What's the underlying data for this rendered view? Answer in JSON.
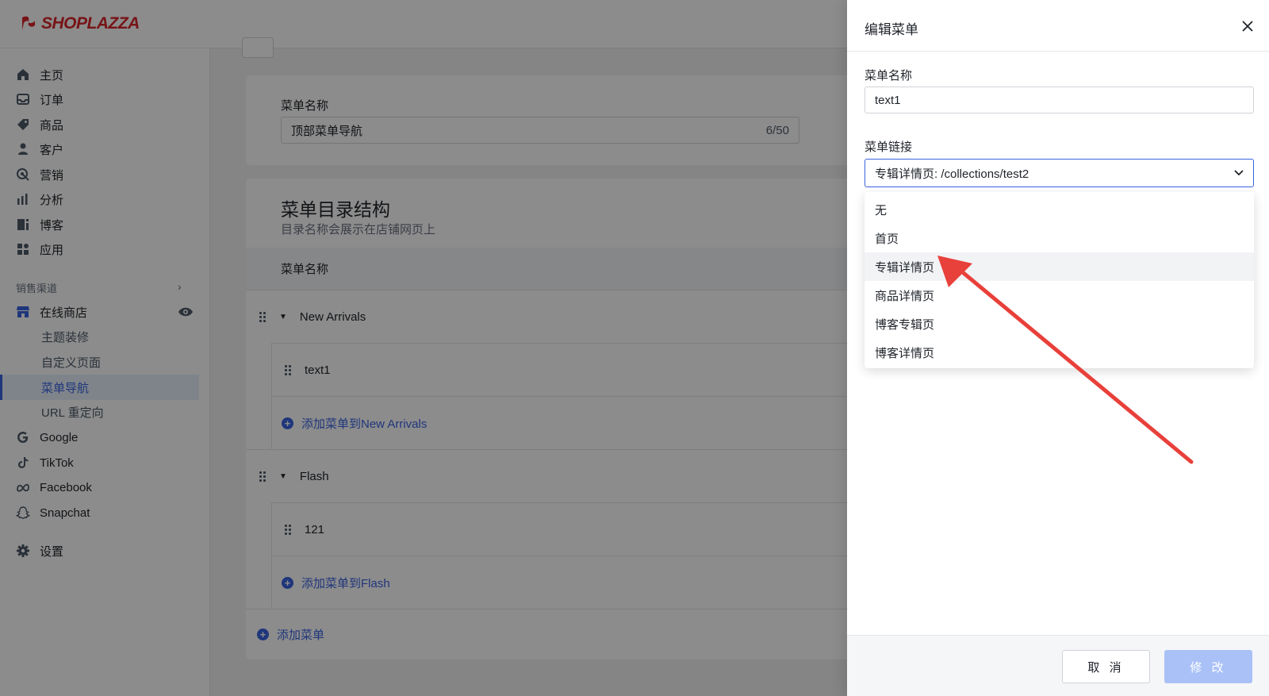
{
  "brand": {
    "name": "SHOPLAZZA",
    "color": "#d9262a"
  },
  "accent": "#3a63e0",
  "sidebar": {
    "items": [
      {
        "label": "主页",
        "icon": "home-icon"
      },
      {
        "label": "订单",
        "icon": "inbox-icon"
      },
      {
        "label": "商品",
        "icon": "tag-icon"
      },
      {
        "label": "客户",
        "icon": "person-icon"
      },
      {
        "label": "营销",
        "icon": "target-icon"
      },
      {
        "label": "分析",
        "icon": "bar-chart-icon"
      },
      {
        "label": "博客",
        "icon": "blog-icon"
      },
      {
        "label": "应用",
        "icon": "apps-icon"
      }
    ],
    "section_label": "销售渠道",
    "store": {
      "label": "在线商店",
      "icon": "store-icon"
    },
    "store_sub": [
      "主题装修",
      "自定义页面",
      "菜单导航",
      "URL 重定向"
    ],
    "active_sub": "菜单导航",
    "channels": [
      {
        "label": "Google",
        "icon": "google-icon"
      },
      {
        "label": "TikTok",
        "icon": "tiktok-icon"
      },
      {
        "label": "Facebook",
        "icon": "meta-icon"
      },
      {
        "label": "Snapchat",
        "icon": "snapchat-icon"
      }
    ],
    "settings": {
      "label": "设置",
      "icon": "gear-icon"
    }
  },
  "main": {
    "name_card": {
      "label": "菜单名称",
      "value": "顶部菜单导航",
      "counter": "6/50"
    },
    "tree": {
      "title": "菜单目录结构",
      "subtitle": "目录名称会展示在店铺网页上",
      "column_header": "菜单名称",
      "groups": [
        {
          "label": "New Arrivals",
          "children": [
            "text1"
          ],
          "add_label": "添加菜单到New Arrivals"
        },
        {
          "label": "Flash",
          "children": [
            "121"
          ],
          "add_label": "添加菜单到Flash"
        }
      ],
      "add_root_label": "添加菜单"
    }
  },
  "drawer": {
    "title": "编辑菜单",
    "name_label": "菜单名称",
    "name_value": "text1",
    "link_label": "菜单链接",
    "link_value": "专辑详情页: /collections/test2",
    "options": [
      "无",
      "首页",
      "专辑详情页",
      "商品详情页",
      "博客专辑页",
      "博客详情页"
    ],
    "highlighted_option": "专辑详情页",
    "cancel_label": "取 消",
    "confirm_label": "修 改"
  }
}
